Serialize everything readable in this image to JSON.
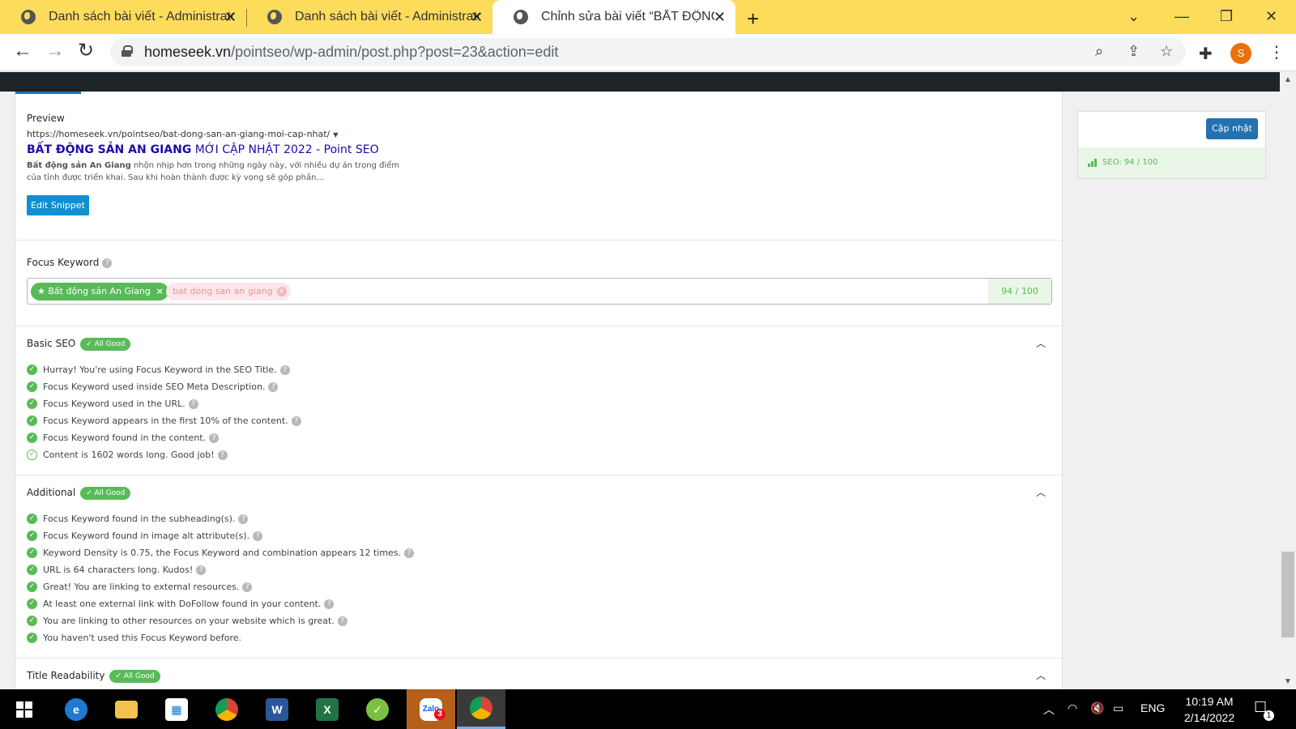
{
  "browser": {
    "tabs": [
      {
        "title": "Danh sách bài viết - Administrator"
      },
      {
        "title": "Danh sách bài viết - Administrator"
      },
      {
        "title": "Chỉnh sửa bài viết “BẤT ĐỘNG SẢN"
      }
    ],
    "url_host": "homeseek.vn",
    "url_path": "/pointseo/wp-admin/post.php?post=23&action=edit",
    "profile_initial": "S"
  },
  "preview": {
    "heading": "Preview",
    "url": "https://homeseek.vn/pointseo/bat-dong-san-an-giang-moi-cap-nhat/",
    "title_bold": "BẤT ĐỘNG SẢN AN GIANG",
    "title_rest": " MỚI CẬP NHẬT 2022 - Point SEO",
    "desc_bold": "Bất động sản An Giang",
    "desc_rest": " nhộn nhịp hơn trong những ngày này, với nhiều dự án trọng điểm của tỉnh được triển khai. Sau khi hoàn thành được kỳ vọng sẽ góp phần...",
    "edit_button": "Edit Snippet"
  },
  "focus": {
    "heading": "Focus Keyword",
    "keyword_primary": "Bất động sản An Giang",
    "keyword_secondary": "bat dong san an giang",
    "score": "94 / 100"
  },
  "basic_seo": {
    "heading": "Basic SEO",
    "badge": "✓ All Good",
    "items": [
      "Hurray! You're using Focus Keyword in the SEO Title.",
      "Focus Keyword used inside SEO Meta Description.",
      "Focus Keyword used in the URL.",
      "Focus Keyword appears in the first 10% of the content.",
      "Focus Keyword found in the content.",
      "Content is 1602 words long. Good job!"
    ]
  },
  "additional": {
    "heading": "Additional",
    "badge": "✓ All Good",
    "items": [
      "Focus Keyword found in the subheading(s).",
      "Focus Keyword found in image alt attribute(s).",
      "Keyword Density is 0.75, the Focus Keyword and combination appears 12 times.",
      "URL is 64 characters long. Kudos!",
      "Great! You are linking to external resources.",
      "At least one external link with DoFollow found in your content.",
      "You are linking to other resources on your website which is great.",
      "You haven't used this Focus Keyword before."
    ]
  },
  "title_readability": {
    "heading": "Title Readability",
    "badge": "✓ All Good"
  },
  "sidebar": {
    "update_button": "Cập nhật",
    "seo_score": "SEO: 94 / 100"
  },
  "taskbar": {
    "time": "10:19 AM",
    "date": "2/14/2022",
    "language": "ENG",
    "zalo_badge": "3",
    "notif_count": "1"
  },
  "colors": {
    "accent_green": "#58bb58",
    "wp_blue": "#2271b1",
    "tab_yellow": "#fddc5c"
  }
}
